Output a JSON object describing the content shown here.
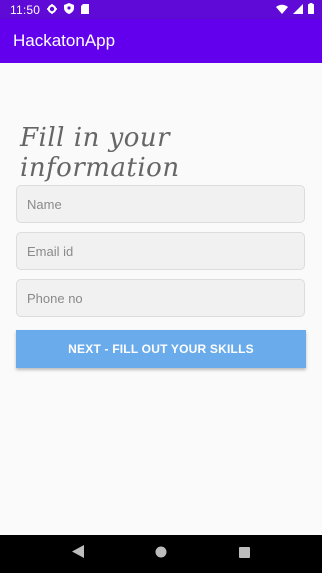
{
  "status_bar": {
    "time": "11:50",
    "left_icons": [
      "gear-icon",
      "shield-icon",
      "sd-card-icon"
    ],
    "right_icons": [
      "wifi-icon",
      "cell-signal-icon",
      "battery-icon"
    ]
  },
  "app_bar": {
    "title": "HackatonApp"
  },
  "form": {
    "heading": "Fill in your information",
    "name_placeholder": "Name",
    "email_placeholder": "Email id",
    "phone_placeholder": "Phone no",
    "next_label": "NEXT - FILL OUT YOUR SKILLS"
  },
  "nav_bar": {
    "buttons": [
      "back-icon",
      "home-icon",
      "recents-icon"
    ]
  },
  "colors": {
    "status_bar": "#5f0ad6",
    "app_bar": "#6200ee",
    "button": "#6aabeb",
    "background": "#fafafa"
  }
}
